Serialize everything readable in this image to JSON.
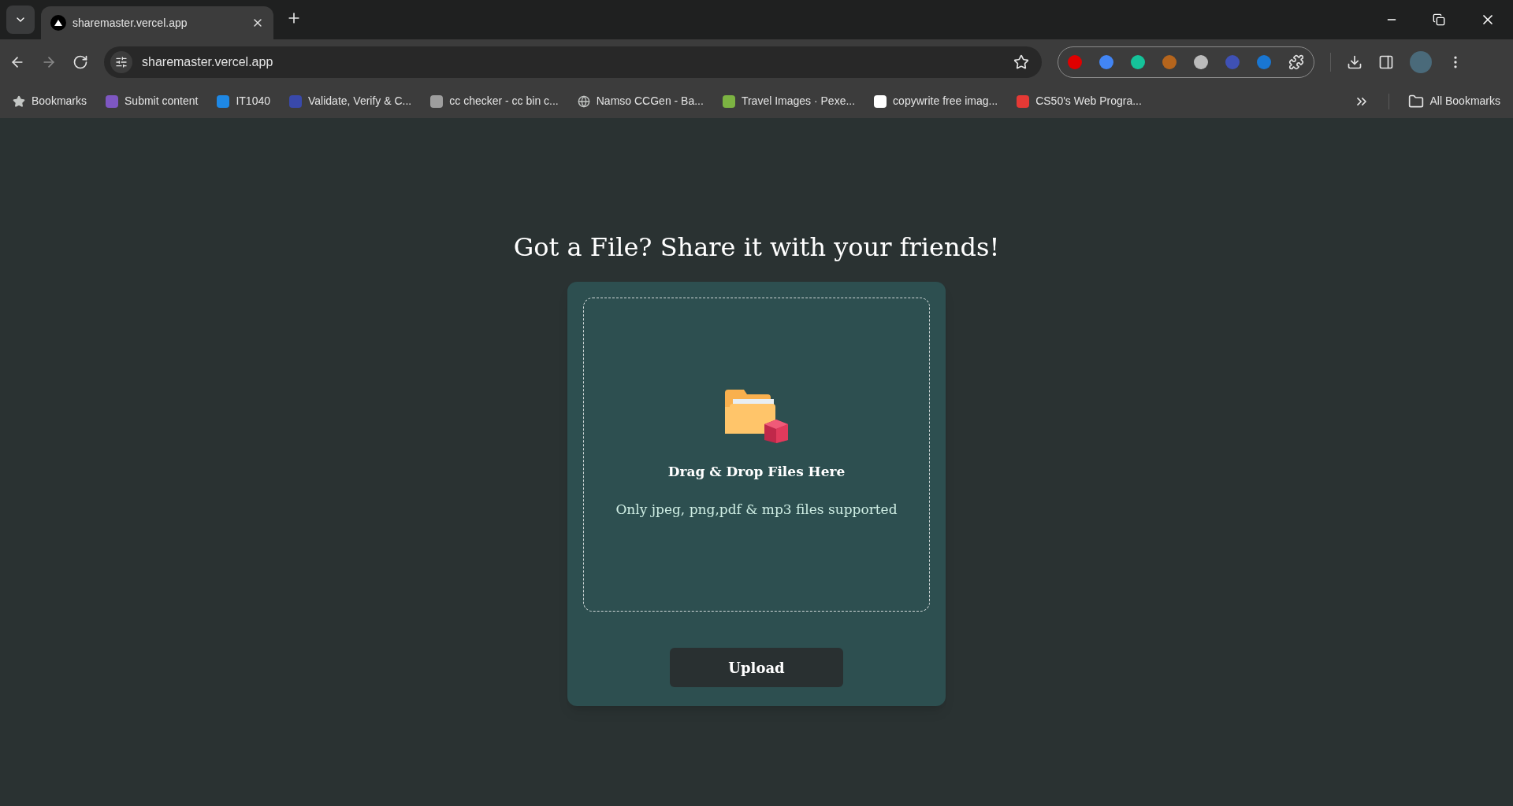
{
  "tabs": [
    {
      "title": "sharemaster.vercel.app",
      "selected": true
    }
  ],
  "address_bar": {
    "url": "sharemaster.vercel.app"
  },
  "bookmarks": [
    {
      "label": "Bookmarks",
      "kind": "star"
    },
    {
      "label": "Submit content",
      "kind": "site"
    },
    {
      "label": "IT1040",
      "kind": "site"
    },
    {
      "label": "Validate, Verify & C...",
      "kind": "site"
    },
    {
      "label": "cc checker - cc bin c...",
      "kind": "site"
    },
    {
      "label": "Namso CCGen - Ba...",
      "kind": "globe"
    },
    {
      "label": "Travel Images · Pexe...",
      "kind": "site"
    },
    {
      "label": "copywrite free imag...",
      "kind": "site"
    },
    {
      "label": "CS50's Web Progra...",
      "kind": "site"
    }
  ],
  "all_bookmarks": "All Bookmarks",
  "page": {
    "heading": "Got a File? Share it with your friends!",
    "drop_title": "Drag & Drop Files Here",
    "drop_hint": "Only jpeg, png,pdf & mp3 files supported",
    "button": "Upload"
  }
}
